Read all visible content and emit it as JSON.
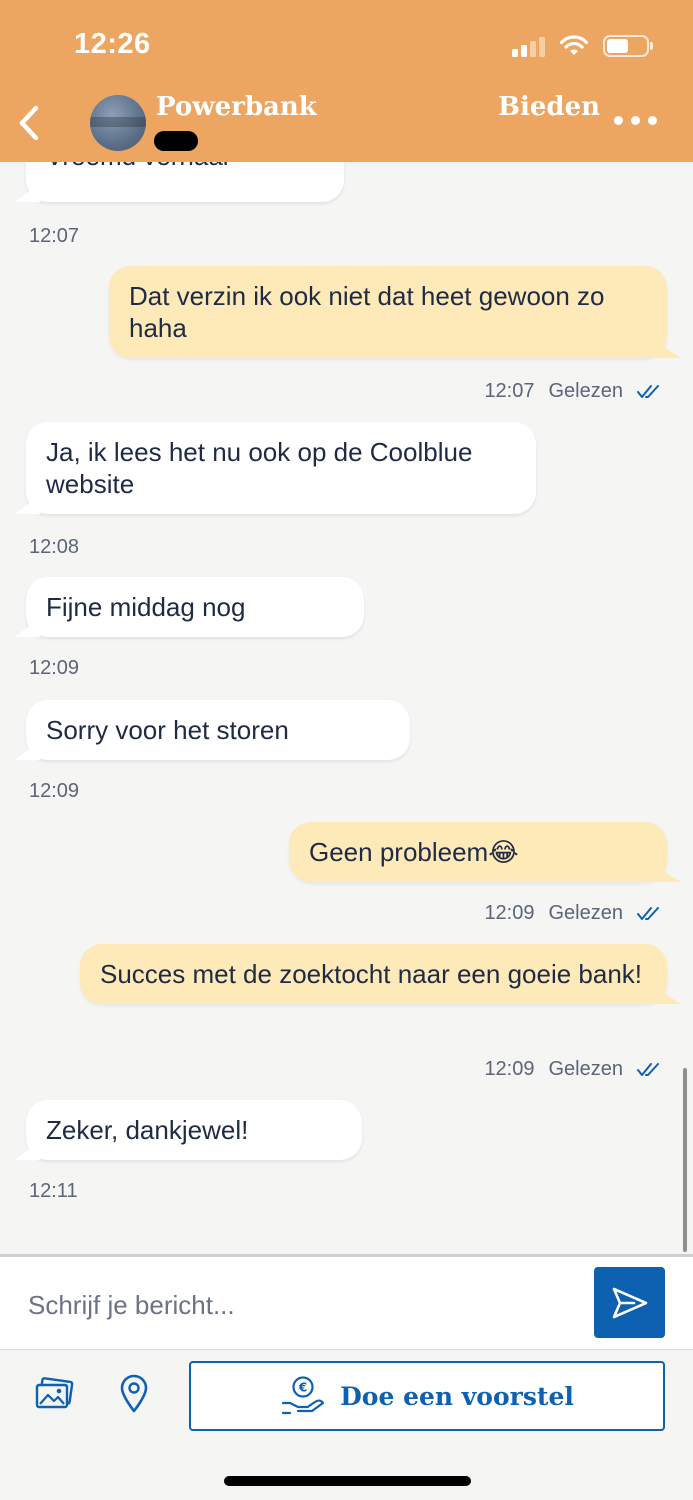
{
  "status_bar": {
    "time": "12:26"
  },
  "header": {
    "title": "Powerbank",
    "bid_label": "Bieden"
  },
  "messages": [
    {
      "direction": "in",
      "text": "Vreemd verhaal",
      "time": "12:07"
    },
    {
      "direction": "out",
      "text": "Dat verzin ik ook niet dat heet gewoon zo haha",
      "time": "12:07",
      "status": "Gelezen"
    },
    {
      "direction": "in",
      "text": "Ja, ik lees het nu ook op de Coolblue website",
      "time": "12:08"
    },
    {
      "direction": "in",
      "text": "Fijne middag nog",
      "time": "12:09"
    },
    {
      "direction": "in",
      "text": "Sorry voor het storen",
      "time": "12:09"
    },
    {
      "direction": "out",
      "text": "Geen probleem😂",
      "time": "12:09",
      "status": "Gelezen"
    },
    {
      "direction": "out",
      "text": "Succes met de zoektocht naar een goeie bank!",
      "time": "12:09",
      "status": "Gelezen"
    },
    {
      "direction": "in",
      "text": "Zeker, dankjewel!",
      "time": "12:11"
    }
  ],
  "composer": {
    "placeholder": "Schrijf je bericht...",
    "offer_label": "Doe een voorstel"
  },
  "colors": {
    "header": "#eda662",
    "incoming_bubble": "#ffffff",
    "outgoing_bubble": "#feeab9",
    "accent_blue": "#0e60b0"
  },
  "icons": [
    "back-arrow-icon",
    "more-options-icon",
    "read-check-icon",
    "send-icon",
    "gallery-icon",
    "location-pin-icon",
    "money-hand-icon"
  ]
}
